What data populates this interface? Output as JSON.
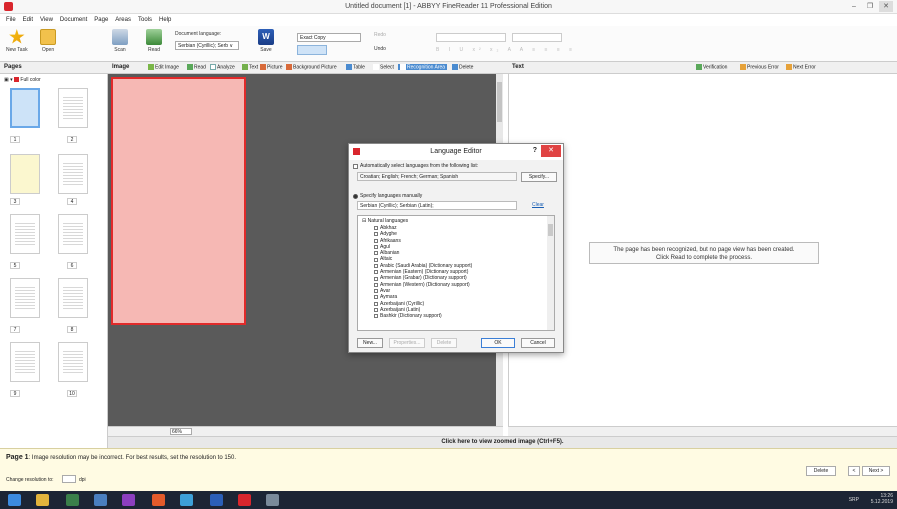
{
  "window": {
    "title": "Untitled document [1] - ABBYY FineReader 11 Professional Edition"
  },
  "menu": [
    "File",
    "Edit",
    "View",
    "Document",
    "Page",
    "Areas",
    "Tools",
    "Help"
  ],
  "ribbon": {
    "new_task": "New Task",
    "open": "Open",
    "scan": "Scan",
    "read": "Read",
    "doc_lang_label": "Document language:",
    "doc_lang_value": "Serbian (Cyrillic); Serb ∨",
    "save": "Save",
    "save_icon": "W",
    "copy_mode": "Exact Copy",
    "redo": "Redo",
    "undo": "Undo"
  },
  "pages_panel": {
    "title": "Pages",
    "color_mode": "Full color",
    "thumb_labels": [
      "1",
      "2",
      "3",
      "4",
      "5",
      "6",
      "7",
      "8",
      "9",
      "10"
    ]
  },
  "image_panel": {
    "title": "Image",
    "tools": [
      "Edit Image",
      "Read",
      "Analyze",
      "Text",
      "Picture",
      "Background Picture",
      "Table",
      "Select",
      "Recognition Area",
      "Delete"
    ],
    "zoom": "66%"
  },
  "text_panel": {
    "title": "Text",
    "tools": [
      "Verification",
      "Previous Error",
      "Next Error"
    ],
    "message_line1": "The page has been recognized, but no page view has been created.",
    "message_line2": "Click Read to complete the process."
  },
  "zoomed_bar": "Click here to view zoomed image (Ctrl+F5).",
  "status": {
    "page_prefix": "Page 1",
    "message": ": Image resolution may be incorrect. For best results, set the resolution to 150.",
    "change_res_label": "Change resolution to:",
    "res_unit": "dpi",
    "delete_btn": "Delete",
    "prev_btn": "<",
    "next_btn": "Next >"
  },
  "taskbar": {
    "lang": "SRP",
    "time": "13:26",
    "date": "5.12.2019"
  },
  "dialog": {
    "title": "Language Editor",
    "help": "?",
    "close": "✕",
    "auto_label": "Automatically select languages from the following list:",
    "auto_value": "Croatian; English; French; German; Spanish",
    "specify_btn": "Specify...",
    "manual_label": "Specify languages manually",
    "manual_value": "Serbian (Cyrillic); Serbian (Latin);",
    "clear": "Clear",
    "tree_root": "⊟ Natural languages",
    "languages": [
      "Abkhaz",
      "Adyghe",
      "Afrikaans",
      "Agul",
      "Albanian",
      "Altaic",
      "Arabic (Saudi Arabia) (Dictionary support)",
      "Armenian (Eastern) (Dictionary support)",
      "Armenian (Grabar) (Dictionary support)",
      "Armenian (Western) (Dictionary support)",
      "Avar",
      "Aymara",
      "Azerbaijani (Cyrillic)",
      "Azerbaijani (Latin)",
      "Bashkir (Dictionary support)"
    ],
    "new_btn": "New...",
    "props_btn": "Properties...",
    "delete_btn": "Delete",
    "ok_btn": "OK",
    "cancel_btn": "Cancel"
  },
  "colors": {
    "accent": "#d9262d",
    "selection": "#6aa8e8",
    "page_tint": "#f6b8b4",
    "status_bg": "#fffbe3"
  }
}
